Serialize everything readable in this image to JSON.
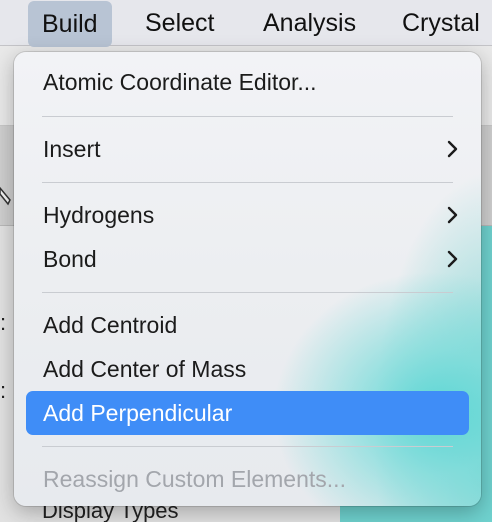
{
  "menubar": {
    "items": [
      {
        "label": "Build",
        "active": true
      },
      {
        "label": "Select",
        "active": false
      },
      {
        "label": "Analysis",
        "active": false
      },
      {
        "label": "Crystal",
        "active": false
      }
    ]
  },
  "background": {
    "labels": [
      ":",
      ":"
    ],
    "partial_label": "Display Types",
    "teal_color": "#6fd2cf"
  },
  "build_menu": {
    "items": [
      {
        "label": "Atomic Coordinate Editor...",
        "submenu": false,
        "state": "normal"
      },
      {
        "label": "Insert",
        "submenu": true,
        "state": "normal"
      },
      {
        "label": "Hydrogens",
        "submenu": true,
        "state": "normal"
      },
      {
        "label": "Bond",
        "submenu": true,
        "state": "normal"
      },
      {
        "label": "Add Centroid",
        "submenu": false,
        "state": "normal"
      },
      {
        "label": "Add Center of Mass",
        "submenu": false,
        "state": "normal"
      },
      {
        "label": "Add Perpendicular",
        "submenu": false,
        "state": "highlighted"
      },
      {
        "label": "Reassign Custom Elements...",
        "submenu": false,
        "state": "disabled"
      }
    ],
    "highlight_color": "#3f8df7",
    "submenu_icon": "chevron-right-icon"
  }
}
